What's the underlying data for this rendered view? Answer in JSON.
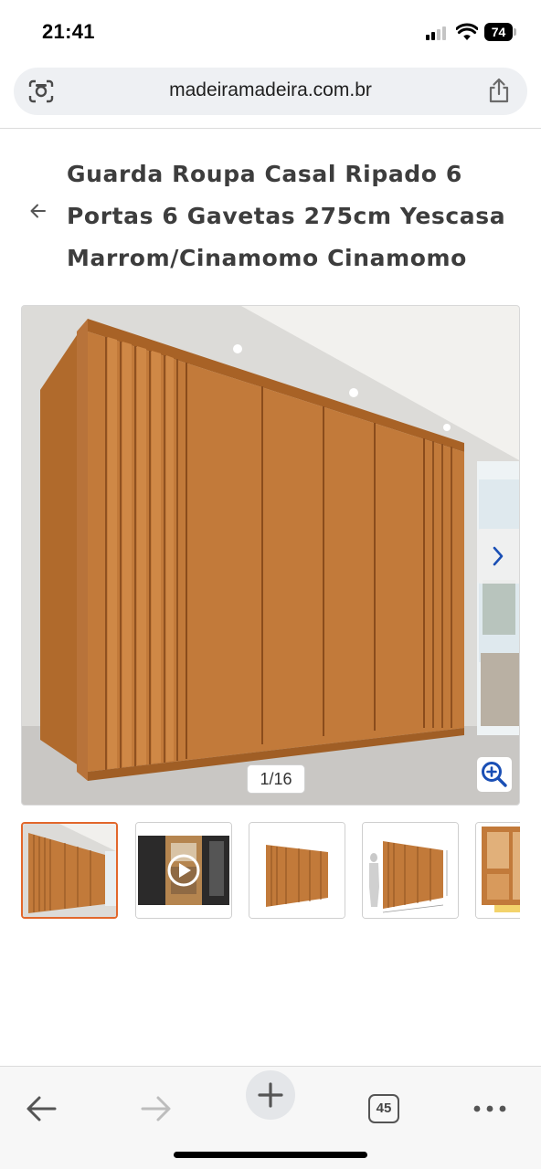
{
  "status_bar": {
    "time": "21:41",
    "battery_level": "74",
    "icons": [
      "cellular-signal-icon",
      "wifi-icon",
      "battery-icon"
    ]
  },
  "browser": {
    "url": "madeiramadeira.com.br",
    "icons": {
      "left": "google-lens-icon",
      "right": "share-icon"
    }
  },
  "product": {
    "title": "Guarda Roupa Casal Ripado 6 Portas 6 Gavetas 275cm Yescasa Marrom/Cinamomo Cinamomo",
    "back_icon": "arrow-left-icon"
  },
  "gallery": {
    "counter": "1/16",
    "current_image": 1,
    "total_images": 16,
    "next_icon": "chevron-right-icon",
    "zoom_icon": "zoom-in-icon",
    "thumbnails": [
      {
        "kind": "photo",
        "active": true
      },
      {
        "kind": "video",
        "active": false
      },
      {
        "kind": "photo",
        "active": false
      },
      {
        "kind": "dimensions",
        "active": false
      },
      {
        "kind": "interior",
        "active": false
      }
    ]
  },
  "toolbar": {
    "tab_count": "45",
    "items": [
      "back-icon",
      "forward-icon",
      "new-tab-icon",
      "tabs-icon",
      "more-icon"
    ]
  },
  "colors": {
    "accent": "#e2672b",
    "wood": "#c27a3a",
    "link_blue": "#1a4fb5"
  }
}
